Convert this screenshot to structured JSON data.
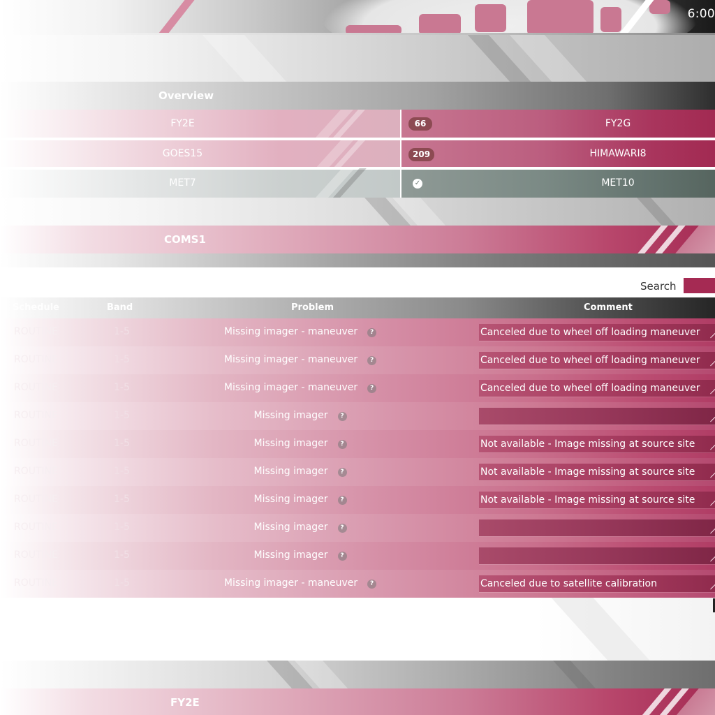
{
  "header": {
    "clock": "6:00"
  },
  "overview": {
    "title": "Overview",
    "rows": [
      {
        "left": "FY2E",
        "badge": "66",
        "right": "FY2G",
        "status": "count"
      },
      {
        "left": "GOES15",
        "badge": "209",
        "right": "HIMAWARI8",
        "status": "count"
      },
      {
        "left": "MET7",
        "badge": "",
        "right": "MET10",
        "status": "ok"
      }
    ]
  },
  "sections": {
    "current": "COMS1",
    "next": "FY2E"
  },
  "search": {
    "label": "Search",
    "value": ""
  },
  "table": {
    "columns": {
      "schedule": "Schedule",
      "band": "Band",
      "problem": "Problem",
      "comment": "Comment"
    },
    "rows": [
      {
        "schedule": "ROUTINE",
        "band": "1-5",
        "problem": "Missing imager - maneuver",
        "comment": "Canceled due to wheel off loading maneuver"
      },
      {
        "schedule": "ROUTINE",
        "band": "1-5",
        "problem": "Missing imager - maneuver",
        "comment": "Canceled due to wheel off loading maneuver"
      },
      {
        "schedule": "ROUTINE",
        "band": "1-5",
        "problem": "Missing imager - maneuver",
        "comment": "Canceled due to wheel off loading maneuver"
      },
      {
        "schedule": "ROUTINE",
        "band": "1-5",
        "problem": "Missing imager",
        "comment": ""
      },
      {
        "schedule": "ROUTINE",
        "band": "1-5",
        "problem": "Missing imager",
        "comment": "Not available - Image missing at source site"
      },
      {
        "schedule": "ROUTINE",
        "band": "1-5",
        "problem": "Missing imager",
        "comment": "Not available - Image missing at source site"
      },
      {
        "schedule": "ROUTINE",
        "band": "1-5",
        "problem": "Missing imager",
        "comment": "Not available - Image missing at source site"
      },
      {
        "schedule": "ROUTINE",
        "band": "1-5",
        "problem": "Missing imager",
        "comment": ""
      },
      {
        "schedule": "ROUTINE",
        "band": "1-5",
        "problem": "Missing imager",
        "comment": ""
      },
      {
        "schedule": "ROUTINE",
        "band": "1-5",
        "problem": "Missing imager - maneuver",
        "comment": "Canceled due to satellite calibration"
      }
    ]
  },
  "icons": {
    "help": "question-circle-icon",
    "ok": "check-circle-icon"
  },
  "colors": {
    "accent": "#a52a53",
    "accent_light": "#d78ca3",
    "ok": "#5a6a63",
    "badge": "#8c4a52"
  }
}
